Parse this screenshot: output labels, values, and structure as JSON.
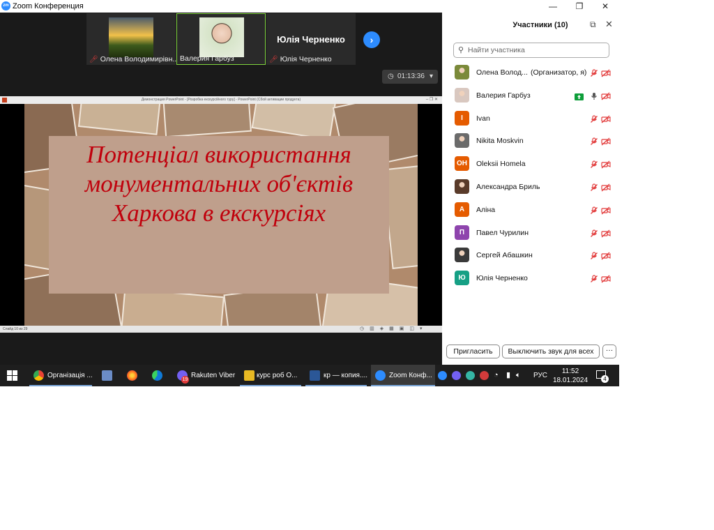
{
  "window": {
    "app_logo": "zm",
    "title": "Zoom Конференция",
    "controls": {
      "minimize": "—",
      "restore": "❐",
      "close": "✕"
    }
  },
  "meeting": {
    "thumbnails": [
      {
        "name": "Олена Володимирівн...",
        "mic": "muted"
      },
      {
        "name": "Валерия Гарбуз",
        "mic": "on"
      },
      {
        "name": "Юлія Черненко",
        "big_name": "Юлія Черненко",
        "mic": "muted"
      }
    ],
    "next_icon": "›",
    "timer": "01:13:36",
    "timer_dropdown": "▾",
    "ppt_title": "Демонстрация PowerPoint - [Розробка екскурсійного туру] - PowerPoint (Сбой активации продукта)",
    "slide_title": "Потенціал використання монументальних об'єктів Харкова в екскурсіях",
    "slide_status": "Слайд 10 из 29"
  },
  "panel": {
    "title": "Участники (10)",
    "search_placeholder": "Найти участника",
    "participants": [
      {
        "name": "Олена Волод...",
        "role": "(Организатор, я)",
        "avatar_type": "photo",
        "avatar_text": "",
        "avatar_color": "#7b8a3a",
        "mic": "muted",
        "video": "off",
        "sharing": false
      },
      {
        "name": "Валерия Гарбуз",
        "role": "",
        "avatar_type": "photo",
        "avatar_text": "",
        "avatar_color": "#d9c8c0",
        "mic": "on",
        "video": "off",
        "sharing": true
      },
      {
        "name": "Ivan",
        "role": "",
        "avatar_type": "letter",
        "avatar_text": "I",
        "avatar_color": "#e55b00",
        "mic": "muted",
        "video": "off",
        "sharing": false
      },
      {
        "name": "Nikita Moskvin",
        "role": "",
        "avatar_type": "photo",
        "avatar_text": "",
        "avatar_color": "#6b6b6b",
        "mic": "muted",
        "video": "off",
        "sharing": false
      },
      {
        "name": "Oleksii Homela",
        "role": "",
        "avatar_type": "letter",
        "avatar_text": "OH",
        "avatar_color": "#e55b00",
        "mic": "muted",
        "video": "off",
        "sharing": false
      },
      {
        "name": "Александра Бриль",
        "role": "",
        "avatar_type": "photo",
        "avatar_text": "",
        "avatar_color": "#5a3b2a",
        "mic": "muted",
        "video": "off",
        "sharing": false
      },
      {
        "name": "Аліна",
        "role": "",
        "avatar_type": "letter",
        "avatar_text": "А",
        "avatar_color": "#e55b00",
        "mic": "muted",
        "video": "off",
        "sharing": false
      },
      {
        "name": "Павел Чурилин",
        "role": "",
        "avatar_type": "letter",
        "avatar_text": "П",
        "avatar_color": "#8e44ad",
        "mic": "muted",
        "video": "off",
        "sharing": false
      },
      {
        "name": "Сергей Абашкин",
        "role": "",
        "avatar_type": "photo",
        "avatar_text": "",
        "avatar_color": "#3a3a3a",
        "mic": "muted",
        "video": "off",
        "sharing": false
      },
      {
        "name": "Юлія Черненко",
        "role": "",
        "avatar_type": "letter",
        "avatar_text": "Ю",
        "avatar_color": "#16a085",
        "mic": "muted",
        "video": "off",
        "sharing": false
      }
    ],
    "invite_label": "Пригласить",
    "mute_all_label": "Выключить звук для всех",
    "more_label": "···"
  },
  "taskbar": {
    "items": [
      {
        "label": "Організація ...",
        "icon": "chrome-icon"
      },
      {
        "label": "",
        "icon": "save-icon"
      },
      {
        "label": "",
        "icon": "firefox-icon"
      },
      {
        "label": "",
        "icon": "edge-icon"
      },
      {
        "label": "Rakuten Viber",
        "icon": "viber-icon",
        "badge": "19"
      },
      {
        "label": "курс роб О...",
        "icon": "folder-icon"
      },
      {
        "label": "кр — копия....",
        "icon": "word-icon"
      },
      {
        "label": "Zoom Конф...",
        "icon": "zoom-icon"
      }
    ],
    "lang": "РУС",
    "time": "11:52",
    "date": "18.01.2024",
    "notifications": "4"
  },
  "colors": {
    "zoom_blue": "#2d8cff",
    "muted_red": "#e23b3b",
    "slide_title_red": "#c0000c",
    "share_green": "#0e9e3a"
  }
}
